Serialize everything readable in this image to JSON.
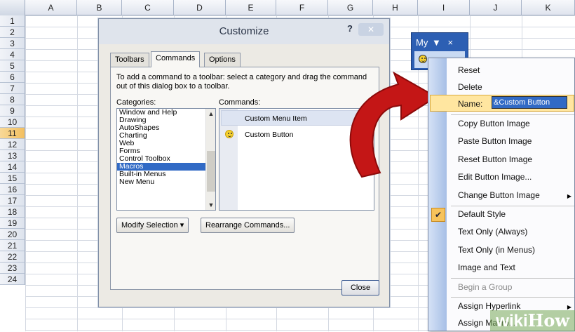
{
  "sheet": {
    "columns": [
      "A",
      "B",
      "C",
      "D",
      "E",
      "F",
      "G",
      "H",
      "I",
      "J",
      "K"
    ],
    "rows": [
      "1",
      "2",
      "3",
      "4",
      "5",
      "6",
      "7",
      "8",
      "9",
      "10",
      "11",
      "12",
      "13",
      "14",
      "15",
      "16",
      "17",
      "18",
      "19",
      "20",
      "21",
      "22",
      "23",
      "24"
    ],
    "selected_row": "11"
  },
  "dialog": {
    "title": "Customize",
    "help": "?",
    "close_x": "✕",
    "tabs": [
      "Toolbars",
      "Commands",
      "Options"
    ],
    "active_tab": "Commands",
    "instructions": "To add a command to a toolbar: select a category and drag the command out of this dialog box to a toolbar.",
    "categories_label": "Categories:",
    "commands_label": "Commands:",
    "categories": [
      "Window and Help",
      "Drawing",
      "AutoShapes",
      "Charting",
      "Web",
      "Forms",
      "Control Toolbox",
      "Macros",
      "Built-in Menus",
      "New Menu"
    ],
    "selected_category": "Macros",
    "commands": [
      "Custom Menu Item",
      "Custom Button"
    ],
    "modify_selection": "Modify Selection ▾",
    "rearrange": "Rearrange Commands...",
    "close": "Close"
  },
  "toolbar": {
    "title": "My",
    "dropdown": "▼",
    "close": "×"
  },
  "menu": {
    "reset": "Reset",
    "delete": "Delete",
    "name_label": "Name:",
    "name_value": "&Custom Button",
    "copy_image": "Copy Button Image",
    "paste_image": "Paste Button Image",
    "reset_image": "Reset Button Image",
    "edit_image": "Edit Button Image...",
    "change_image": "Change Button Image",
    "default_style": "Default Style",
    "text_only_always": "Text Only (Always)",
    "text_only_menus": "Text Only (in Menus)",
    "image_and_text": "Image and Text",
    "begin_group": "Begin a Group",
    "assign_hyperlink": "Assign Hyperlink",
    "assign_macro": "Assign Macro...",
    "checked_item": "Default Style",
    "accent": "#316ac5"
  },
  "watermark": {
    "part1": "wiki",
    "part2": "How"
  }
}
